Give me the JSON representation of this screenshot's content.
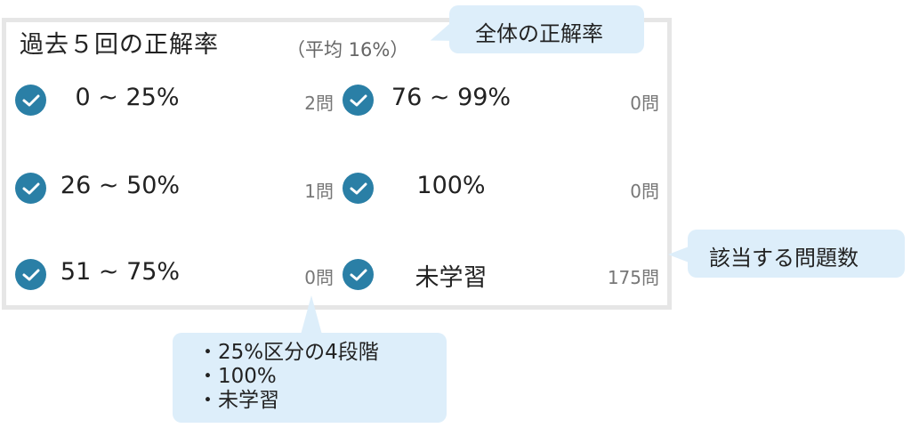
{
  "panel": {
    "title": "過去５回の正解率",
    "average": "（平均 16%）",
    "left_column": [
      {
        "range": "0 ~ 25%",
        "count": "2問",
        "checked": true
      },
      {
        "range": "26 ~ 50%",
        "count": "1問",
        "checked": true
      },
      {
        "range": "51 ~ 75%",
        "count": "0問",
        "checked": true
      }
    ],
    "right_column": [
      {
        "range": "76 ~ 99%",
        "count": "0問",
        "checked": true
      },
      {
        "range": "100%",
        "count": "0問",
        "checked": true
      },
      {
        "range": "未学習",
        "count": "175問",
        "checked": true
      }
    ]
  },
  "callouts": {
    "overall": "全体の正解率",
    "count_note": "該当する問題数",
    "ranges_note": [
      "・25%区分の4段階",
      "・100%",
      "・未学習"
    ]
  },
  "colors": {
    "check_bg": "#2a7fa6",
    "callout_bg": "#ddeefa",
    "panel_border": "#e6e6e6"
  },
  "icons": {
    "check": "check-circle-icon"
  }
}
